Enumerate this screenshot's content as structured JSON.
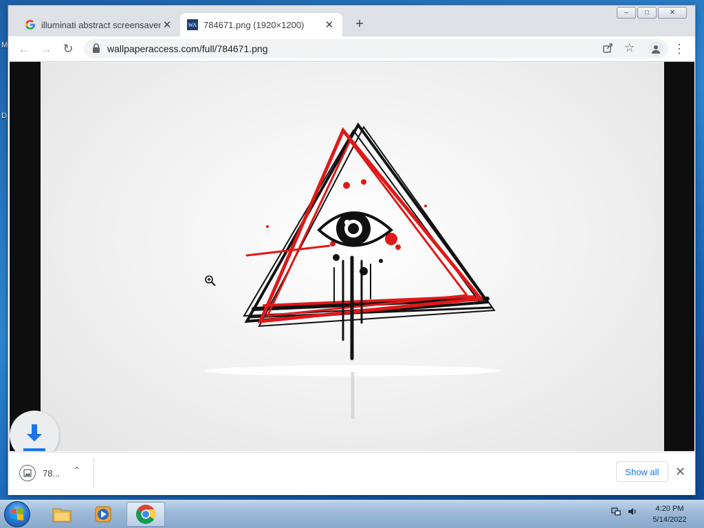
{
  "desktop": {
    "icon_labels": [
      "M",
      "D"
    ]
  },
  "browser": {
    "window_controls": [
      "minimize",
      "maximize",
      "close"
    ],
    "tabs": [
      {
        "title": "illuminati abstract screensaver - G",
        "favicon": "google-g-icon",
        "active": false
      },
      {
        "title": "784671.png (1920×1200)",
        "favicon": "wa",
        "active": true
      }
    ],
    "new_tab_label": "+",
    "address": {
      "url": "wallpaperaccess.com/full/784671.png"
    },
    "downloads": {
      "item_name": "78...",
      "show_all_label": "Show all"
    }
  },
  "taskbar": {
    "apps": [
      "windows-start",
      "file-explorer",
      "media-player",
      "chrome"
    ],
    "clock": {
      "time": "4:20 PM",
      "date": "5/14/2022"
    }
  },
  "colors": {
    "accent_blue": "#1a73e8",
    "artwork_red": "#e01818",
    "artwork_black": "#111111"
  }
}
